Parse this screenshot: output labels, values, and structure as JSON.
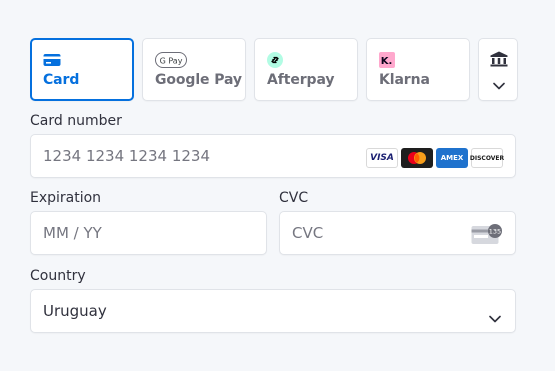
{
  "tabs": [
    {
      "label": "Card",
      "icon": "card-icon",
      "selected": true
    },
    {
      "label": "Google Pay",
      "icon": "google-pay-icon",
      "badge": "G Pay"
    },
    {
      "label": "Afterpay",
      "icon": "afterpay-icon"
    },
    {
      "label": "Klarna",
      "icon": "klarna-icon",
      "badge": "K."
    }
  ],
  "more_tab": {
    "icon": "bank-icon"
  },
  "card_number": {
    "label": "Card number",
    "placeholder": "1234 1234 1234 1234",
    "brands": [
      "VISA",
      "mastercard",
      "AMEX",
      "DISCOVER"
    ]
  },
  "expiration": {
    "label": "Expiration",
    "placeholder": "MM / YY"
  },
  "cvc": {
    "label": "CVC",
    "placeholder": "CVC",
    "icon_text": "135"
  },
  "country": {
    "label": "Country",
    "value": "Uruguay"
  },
  "colors": {
    "accent": "#0570de",
    "border": "#e0e3e8",
    "background": "#f5f7fa"
  }
}
